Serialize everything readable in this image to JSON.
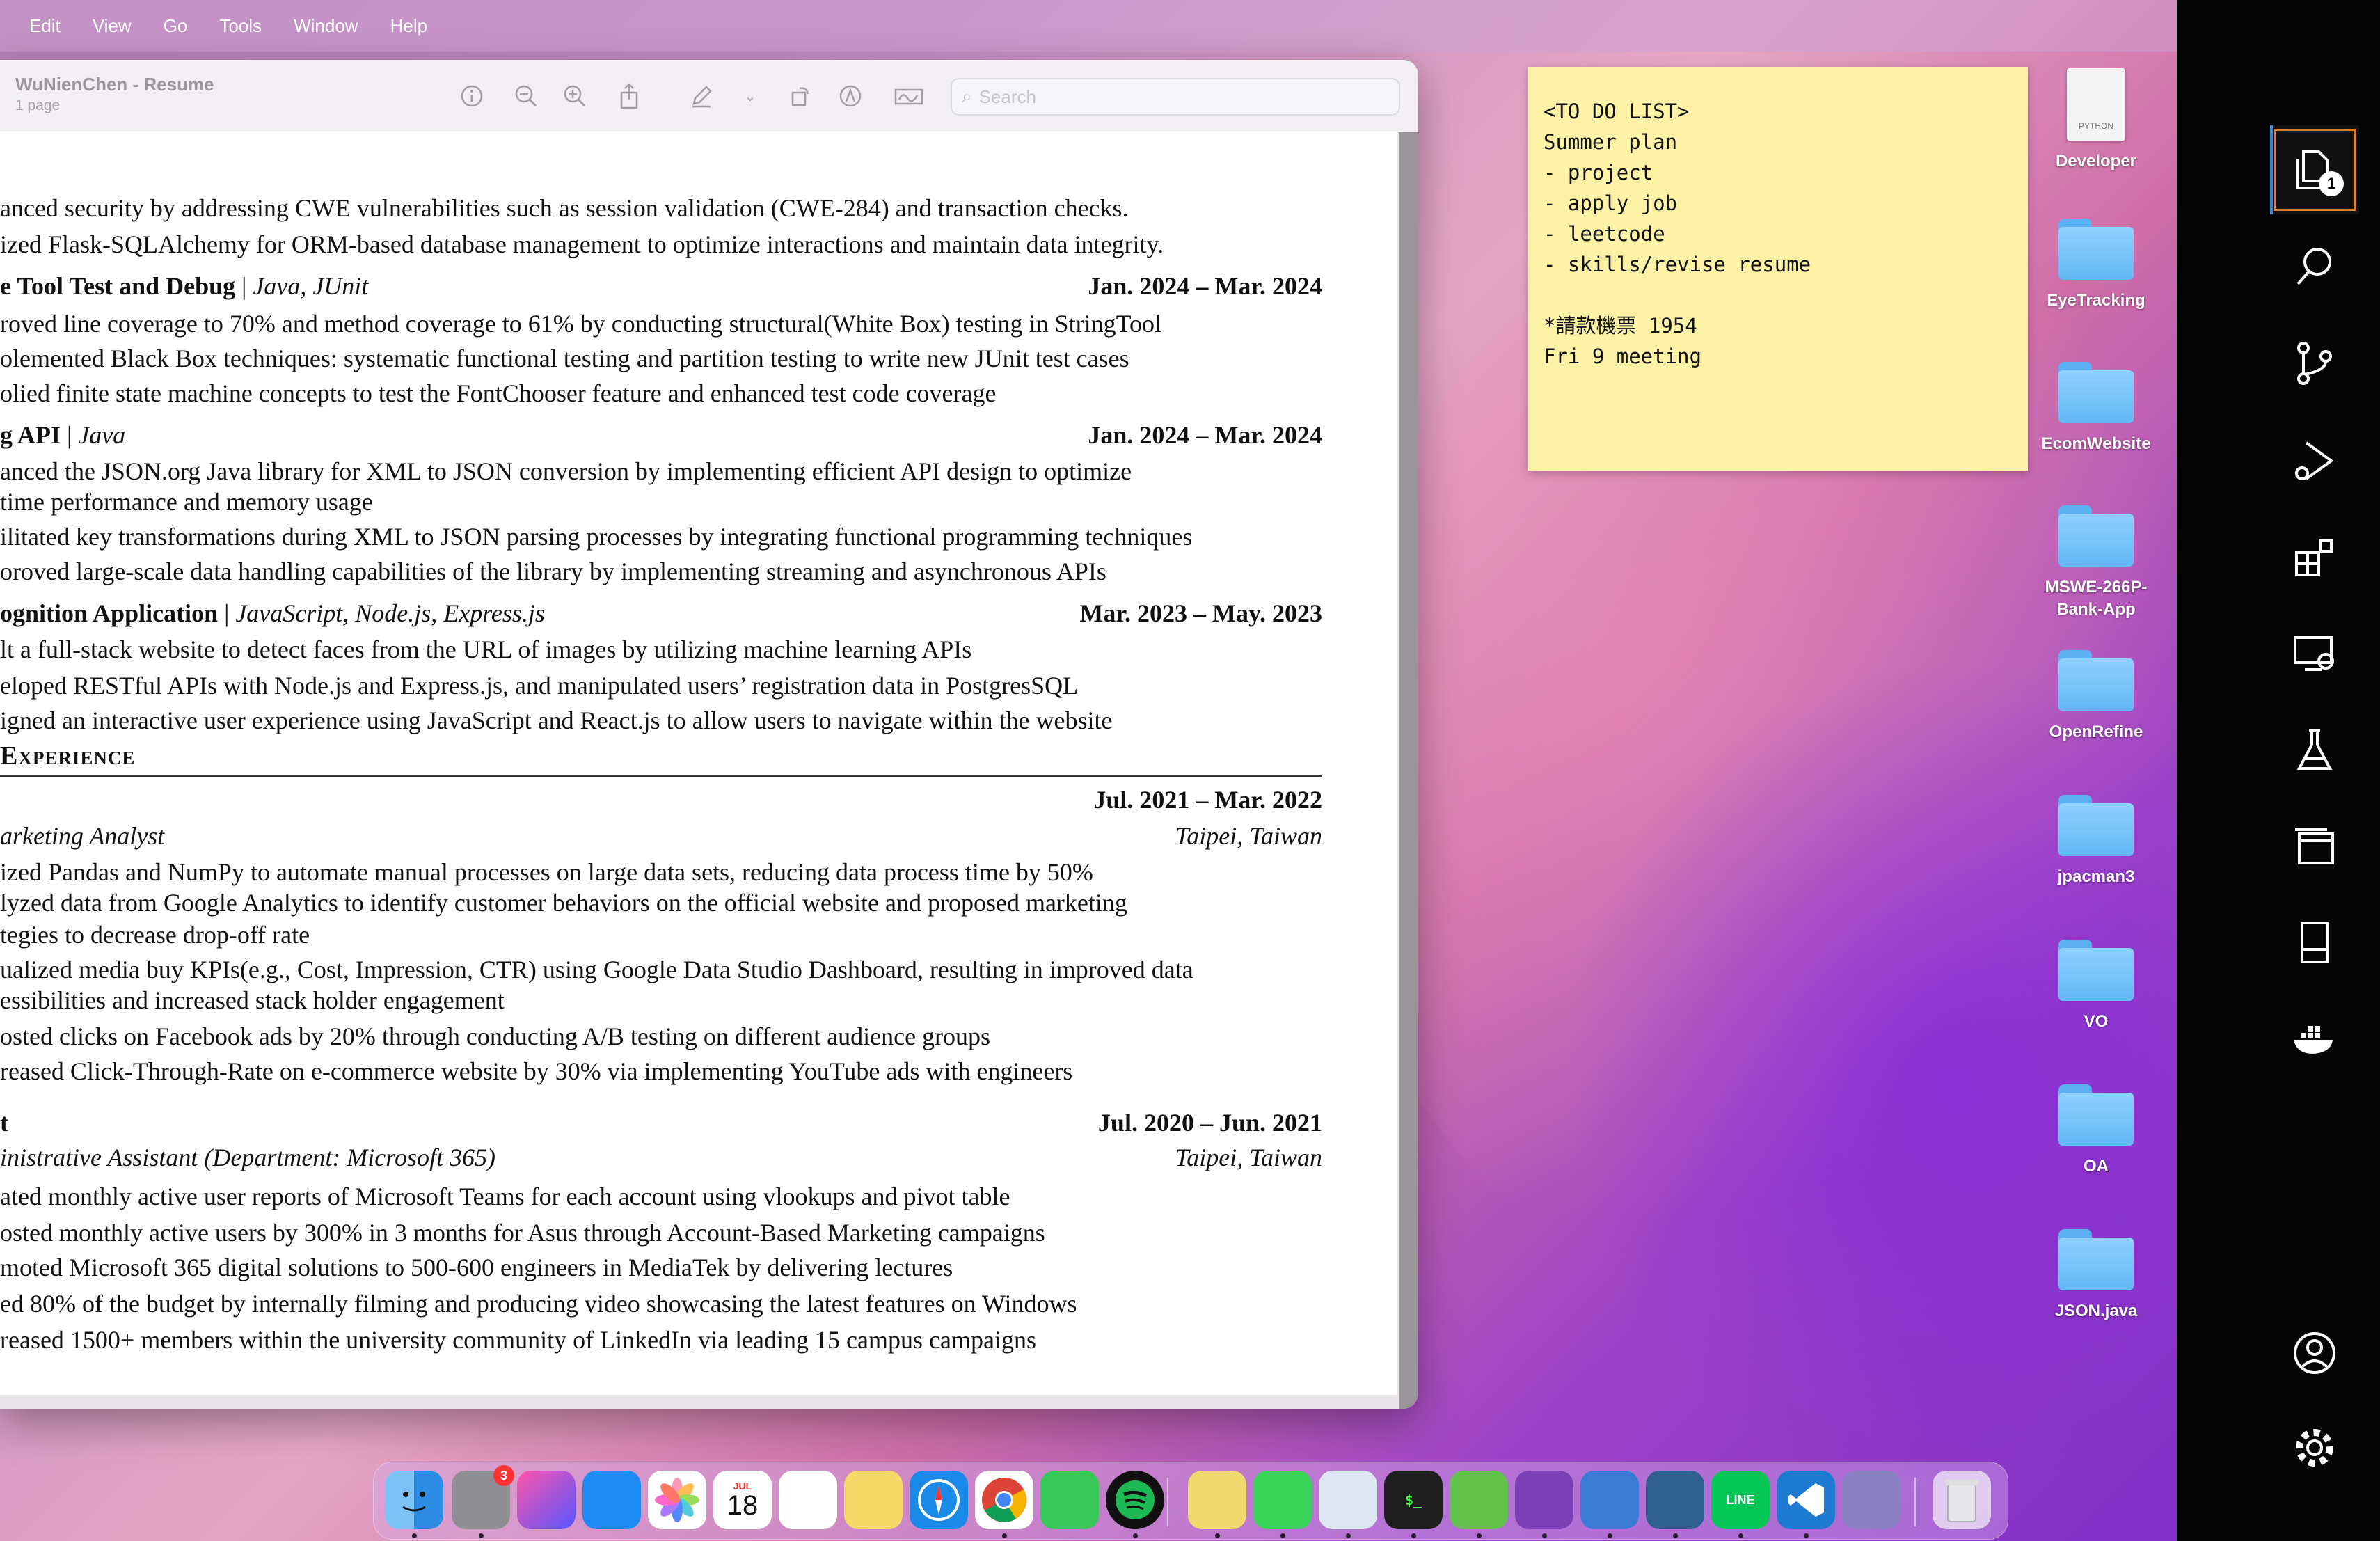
{
  "menu": [
    "Edit",
    "View",
    "Go",
    "Tools",
    "Window",
    "Help"
  ],
  "preview": {
    "title": "WuNienChen - Resume",
    "pages": "1 page",
    "search_placeholder": "Search"
  },
  "resume": {
    "lines": [
      {
        "text": "anced security by addressing CWE vulnerabilities such as session validation (CWE-284) and transaction checks."
      },
      {
        "text": "ized Flask-SQLAlchemy for ORM-based database management to optimize interactions and maintain data integrity."
      },
      {
        "title": "e Tool Test and Debug",
        "tech": "Java, JUnit",
        "date": "Jan. 2024 – Mar. 2024"
      },
      {
        "text": "roved line coverage to 70% and method coverage to 61% by conducting structural(White Box) testing in StringTool"
      },
      {
        "text": "olemented Black Box techniques: systematic functional testing and partition testing to write new JUnit test cases"
      },
      {
        "text": "olied finite state machine concepts to test the FontChooser feature and enhanced test code coverage"
      },
      {
        "title": "g API",
        "tech": "Java",
        "date": "Jan. 2024 – Mar. 2024"
      },
      {
        "text": "anced the JSON.org Java library for XML to JSON conversion by implementing efficient API design to optimize"
      },
      {
        "text": "time performance and memory usage"
      },
      {
        "text": "ilitated key transformations during XML to JSON parsing processes by integrating functional programming techniques"
      },
      {
        "text": "oroved large-scale data handling capabilities of the library by implementing streaming and asynchronous APIs"
      },
      {
        "title": "ognition Application",
        "tech": "JavaScript, Node.js, Express.js",
        "date": "Mar. 2023 – May. 2023"
      },
      {
        "text": "lt a full-stack website to detect faces from the URL of images by utilizing machine learning APIs"
      },
      {
        "text": "eloped RESTful APIs with Node.js and Express.js, and manipulated users’ registration data in PostgresSQL"
      },
      {
        "text": "igned an interactive user experience using JavaScript and React.js to allow users to navigate within the website"
      },
      {
        "section": "Experience"
      },
      {
        "date_only": "Jul. 2021 – Mar. 2022"
      },
      {
        "role": "arketing Analyst",
        "location": "Taipei, Taiwan"
      },
      {
        "text": "ized Pandas and NumPy to automate manual processes on large data sets, reducing data process time by 50%"
      },
      {
        "text": "lyzed data from Google Analytics to identify customer behaviors on the official website and proposed marketing"
      },
      {
        "text": "tegies to decrease drop-off rate"
      },
      {
        "text": "ualized media buy KPIs(e.g., Cost, Impression, CTR) using Google Data Studio Dashboard, resulting in improved data"
      },
      {
        "text": "essibilities and increased stack holder engagement"
      },
      {
        "text": "osted clicks on Facebook ads by 20% through conducting A/B testing on different audience groups"
      },
      {
        "text": "reased Click-Through-Rate on e-commerce website by 30% via implementing YouTube ads with engineers"
      },
      {
        "company": "t",
        "date": "Jul. 2020 – Jun. 2021"
      },
      {
        "role": "inistrative Assistant (Department: Microsoft 365)",
        "location": "Taipei, Taiwan"
      },
      {
        "text": "ated monthly active user reports of Microsoft Teams for each account using vlookups and pivot table"
      },
      {
        "text": "osted monthly active users by 300% in 3 months for Asus through Account-Based Marketing campaigns"
      },
      {
        "text": "moted Microsoft 365 digital solutions to 500-600 engineers in MediaTek by delivering lectures"
      },
      {
        "text": "ed 80% of the budget by internally filming and producing video showcasing the latest features on Windows"
      },
      {
        "text": "reased 1500+ members within the university community of LinkedIn via leading 15 campus campaigns"
      }
    ]
  },
  "sticky": [
    "<TO DO LIST>",
    "Summer plan",
    "- project",
    "- apply job",
    "- leetcode",
    "- skills/revise resume",
    "",
    "*請款機票 1954",
    "Fri 9 meeting"
  ],
  "desktop": {
    "file": {
      "label": "Developer",
      "file_tag": "PYTHON"
    },
    "folders": [
      "EyeTracking",
      "EcomWebsite",
      "MSWE-266P-Bank-App",
      "OpenRefine",
      "jpacman3",
      "VO",
      "OA",
      "JSON.java"
    ]
  },
  "activity_bar": {
    "explorer_badge": "1",
    "icons": [
      "explorer-icon",
      "search-icon",
      "source-control-icon",
      "run-debug-icon",
      "extensions-icon",
      "remote-explorer-icon",
      "testing-icon",
      "window-icon",
      "bookmark-icon",
      "docker-icon",
      "account-icon",
      "settings-icon"
    ]
  },
  "dock": {
    "settings_badge": "3",
    "calendar_month": "JUL",
    "calendar_day": "18",
    "apps": [
      "finder",
      "system-settings",
      "launchpad",
      "app-store",
      "photos",
      "calendar",
      "reminders",
      "notes",
      "safari",
      "chrome",
      "facetime",
      "spotify",
      "stickies",
      "messages",
      "preview",
      "terminal",
      "zipper",
      "github-desktop",
      "network-app",
      "mysql-workbench",
      "line",
      "vscode",
      "rocket",
      "trash"
    ],
    "line_label": "LINE"
  }
}
